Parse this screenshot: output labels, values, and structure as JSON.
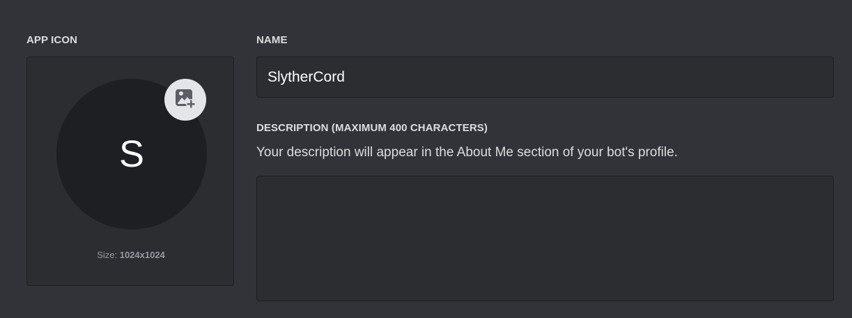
{
  "app_icon": {
    "label": "APP ICON",
    "initial": "S",
    "size_prefix": "Size:",
    "size_value": "1024x1024",
    "upload_icon": "image-plus-icon"
  },
  "name": {
    "label": "NAME",
    "value": "SlytherCord"
  },
  "description": {
    "label": "DESCRIPTION (MAXIMUM 400 CHARACTERS)",
    "help": "Your description will appear in the About Me section of your bot's profile.",
    "value": ""
  },
  "colors": {
    "background": "#313338",
    "panel": "#2b2d31",
    "avatar": "#1e1f22",
    "badge": "#e3e5e8"
  }
}
